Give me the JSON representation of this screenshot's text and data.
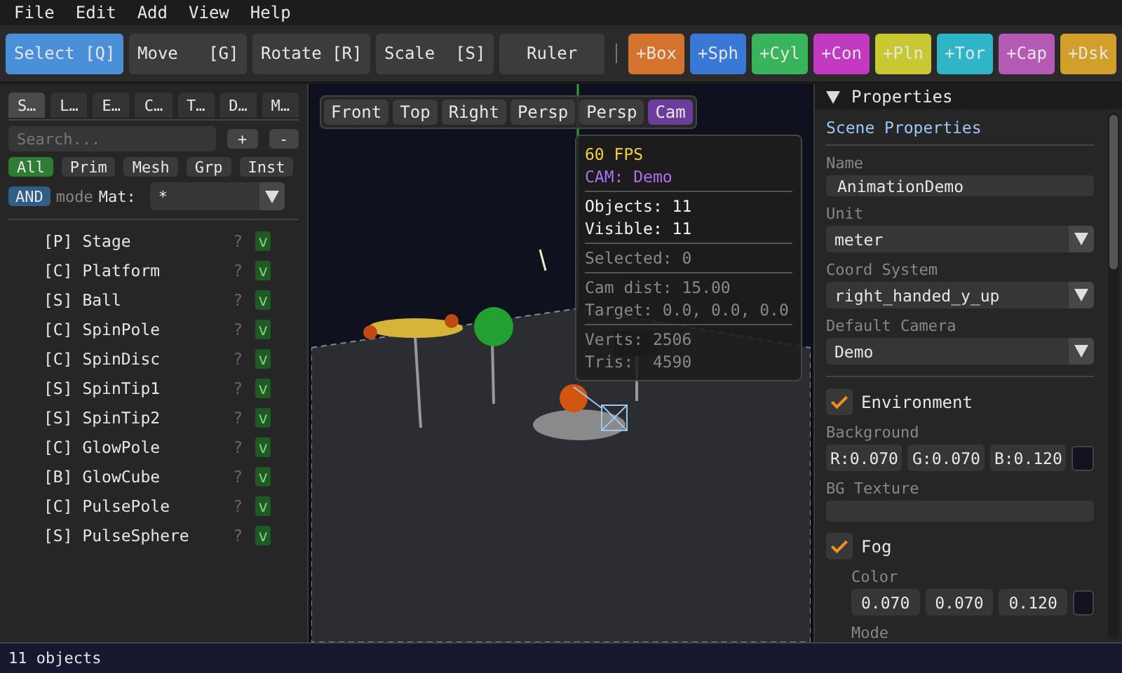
{
  "menu": [
    "File",
    "Edit",
    "Add",
    "View",
    "Help"
  ],
  "tools": [
    {
      "label": "Select [Q]",
      "selected": true
    },
    {
      "label": "Move   [G]",
      "selected": false
    },
    {
      "label": "Rotate [R]",
      "selected": false
    },
    {
      "label": "Scale  [S]",
      "selected": false
    },
    {
      "label": "Ruler",
      "selected": false
    }
  ],
  "add_buttons": [
    {
      "label": "+Box",
      "color": "#d4732e"
    },
    {
      "label": "+Sph",
      "color": "#3a78d6"
    },
    {
      "label": "+Cyl",
      "color": "#38b45c"
    },
    {
      "label": "+Con",
      "color": "#c23ac2"
    },
    {
      "label": "+Pln",
      "color": "#c8c832"
    },
    {
      "label": "+Tor",
      "color": "#30b4c8"
    },
    {
      "label": "+Cap",
      "color": "#b45ab4"
    },
    {
      "label": "+Dsk",
      "color": "#d2a02a"
    }
  ],
  "outliner": {
    "tabs": [
      {
        "label": "S…",
        "selected": true
      },
      {
        "label": "L…",
        "selected": false
      },
      {
        "label": "E…",
        "selected": false
      },
      {
        "label": "C…",
        "selected": false
      },
      {
        "label": "T…",
        "selected": false
      },
      {
        "label": "D…",
        "selected": false
      },
      {
        "label": "M…",
        "selected": false
      }
    ],
    "search": {
      "placeholder": "Search..."
    },
    "search_buttons": [
      "+",
      "-"
    ],
    "filters": [
      {
        "label": "All",
        "selected": true
      },
      {
        "label": "Prim",
        "selected": false
      },
      {
        "label": "Mesh",
        "selected": false
      },
      {
        "label": "Grp",
        "selected": false
      },
      {
        "label": "Inst",
        "selected": false
      }
    ],
    "logic": {
      "label": "AND",
      "mode": "mode"
    },
    "material": {
      "label": "Mat:",
      "value": "*"
    },
    "items": [
      {
        "label": "[P] Stage",
        "hint": "?",
        "badge": "v",
        "visible": true
      },
      {
        "label": "[C] Platform",
        "hint": "?",
        "badge": "v",
        "visible": true
      },
      {
        "label": "[S] Ball",
        "hint": "?",
        "badge": "v",
        "visible": true
      },
      {
        "label": "[C] SpinPole",
        "hint": "?",
        "badge": "v",
        "visible": true
      },
      {
        "label": "[C] SpinDisc",
        "hint": "?",
        "badge": "v",
        "visible": true
      },
      {
        "label": "[S] SpinTip1",
        "hint": "?",
        "badge": "v",
        "visible": true
      },
      {
        "label": "[S] SpinTip2",
        "hint": "?",
        "badge": "v",
        "visible": true
      },
      {
        "label": "[C] GlowPole",
        "hint": "?",
        "badge": "v",
        "visible": true
      },
      {
        "label": "[B] GlowCube",
        "hint": "?",
        "badge": "v",
        "visible": true
      },
      {
        "label": "[C] PulsePole",
        "hint": "?",
        "badge": "v",
        "visible": true
      },
      {
        "label": "[S] PulseSphere",
        "hint": "?",
        "badge": "v",
        "visible": true
      }
    ]
  },
  "viewport": {
    "view_buttons": [
      {
        "label": "Front",
        "selected": false
      },
      {
        "label": "Top",
        "selected": false
      },
      {
        "label": "Right",
        "selected": false
      },
      {
        "label": "Persp",
        "selected": false
      },
      {
        "label": "Persp",
        "selected": false
      },
      {
        "label": "Cam",
        "selected": true
      }
    ],
    "stats": [
      [
        {
          "kind": "fps",
          "text": "60 FPS"
        },
        {
          "kind": "camera",
          "text": "CAM: Demo"
        }
      ],
      [
        {
          "kind": "primary",
          "text": "Objects: 11"
        },
        {
          "kind": "primary",
          "text": "Visible: 11"
        }
      ],
      [
        {
          "kind": "secondary",
          "text": "Selected: 0"
        }
      ],
      [
        {
          "kind": "secondary",
          "text": "Cam dist: 15.00"
        },
        {
          "kind": "secondary",
          "text": "Target: 0.0, 0.0, 0.0"
        }
      ],
      [
        {
          "kind": "secondary",
          "text": "Verts: 2506"
        },
        {
          "kind": "secondary",
          "text": "Tris:  4590"
        }
      ]
    ]
  },
  "properties": {
    "title": "Properties",
    "expanded": true,
    "heading": "Scene Properties",
    "fields": [
      {
        "kind": "text",
        "label": "Name",
        "value": "AnimationDemo"
      },
      {
        "kind": "combo",
        "label": "Unit",
        "value": "meter"
      },
      {
        "kind": "combo",
        "label": "Coord System",
        "value": "right_handed_y_up"
      },
      {
        "kind": "combo",
        "label": "Default Camera",
        "value": "Demo"
      }
    ],
    "environment": {
      "label": "Environment",
      "checked": true,
      "background_label": "Background",
      "background": {
        "values": [
          "R:0.070",
          "G:0.070",
          "B:0.120"
        ],
        "color": "#121220"
      },
      "texture_label": "BG Texture"
    },
    "fog": {
      "label": "Fog",
      "checked": true,
      "color_label": "Color",
      "color_values": [
        "0.070",
        "0.070",
        "0.120"
      ],
      "color": "#121220",
      "mode_label": "Mode"
    }
  },
  "status_bar": "11 objects"
}
